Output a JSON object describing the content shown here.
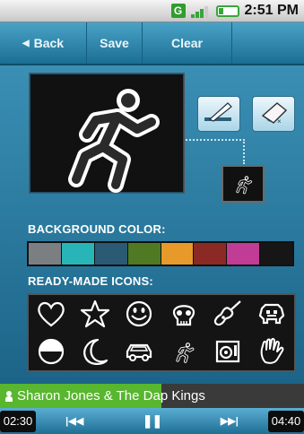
{
  "status_bar": {
    "network_badge": "G",
    "time": "2:51 PM",
    "battery_color": "#3aa53a"
  },
  "toolbar": {
    "back_label": "Back",
    "save_label": "Save",
    "clear_label": "Clear"
  },
  "editor": {
    "pen_tool_icon": "pen-icon",
    "eraser_tool_icon": "eraser-icon",
    "current_icon": "running-man-icon"
  },
  "background_color": {
    "label": "BACKGROUND COLOR:",
    "swatches": [
      "#7c7f82",
      "#27b5b8",
      "#2b5a74",
      "#4f7a23",
      "#e79a2a",
      "#8b2a25",
      "#c03c95",
      "#161616"
    ]
  },
  "ready_made_icons": {
    "label": "READY-MADE ICONS:",
    "items": [
      "heart-icon",
      "star-icon",
      "smiley-icon",
      "skull-icon",
      "guitar-icon",
      "space-invader-icon",
      "circle-icon",
      "moon-icon",
      "car-icon",
      "running-man-icon",
      "speaker-icon",
      "hand-icon"
    ]
  },
  "now_playing": {
    "artist": "Sharon Jones & The Dap Kings",
    "progress": 0.53,
    "progress_color": "#58b62f"
  },
  "player": {
    "elapsed": "02:30",
    "total": "04:40",
    "prev_label": "|◀◀",
    "play_label": "❚❚",
    "next_label": "▶▶|"
  }
}
